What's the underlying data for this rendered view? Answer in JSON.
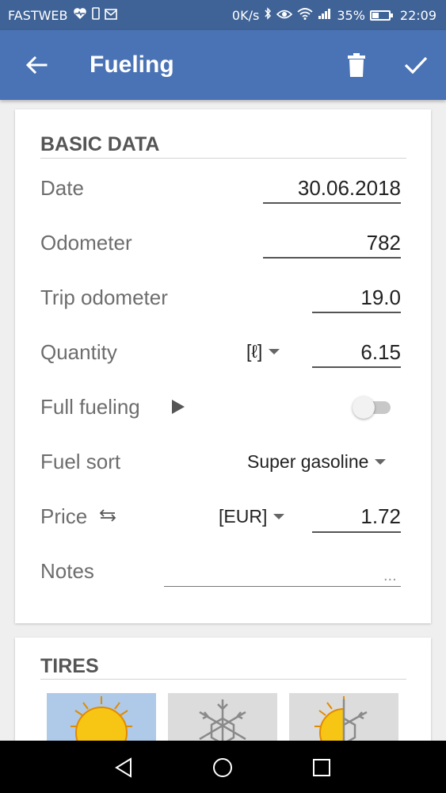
{
  "status_bar": {
    "carrier": "FASTWEB",
    "speed": "0K/s",
    "battery": "35%",
    "time": "22:09",
    "icons": [
      "heart-pulse-icon",
      "phone-icon",
      "mail-icon",
      "bluetooth-icon",
      "eye-icon",
      "wifi-icon",
      "signal-icon",
      "battery-icon"
    ]
  },
  "app_bar": {
    "title": "Fueling",
    "back_icon": "arrow-back-icon",
    "delete_icon": "trash-icon",
    "confirm_icon": "check-icon",
    "color": "#4a73b5"
  },
  "basic_data": {
    "title": "BASIC DATA",
    "date": {
      "label": "Date",
      "value": "30.06.2018"
    },
    "odometer": {
      "label": "Odometer",
      "value": "782"
    },
    "trip_odometer": {
      "label": "Trip odometer",
      "value": "19.0"
    },
    "quantity": {
      "label": "Quantity",
      "unit": "[ℓ]",
      "value": "6.15"
    },
    "full_fueling": {
      "label": "Full fueling",
      "checked": false
    },
    "fuel_sort": {
      "label": "Fuel sort",
      "value": "Super gasoline"
    },
    "price": {
      "label": "Price",
      "currency": "[EUR]",
      "value": "1.72"
    },
    "notes": {
      "label": "Notes",
      "placeholder": "..."
    }
  },
  "tires": {
    "title": "TIRES",
    "options": [
      "summer-tires-icon",
      "winter-tires-icon",
      "all-season-tires-icon"
    ]
  },
  "nav_bar": {
    "icons": [
      "back-triangle-icon",
      "home-circle-icon",
      "recents-square-icon"
    ]
  }
}
